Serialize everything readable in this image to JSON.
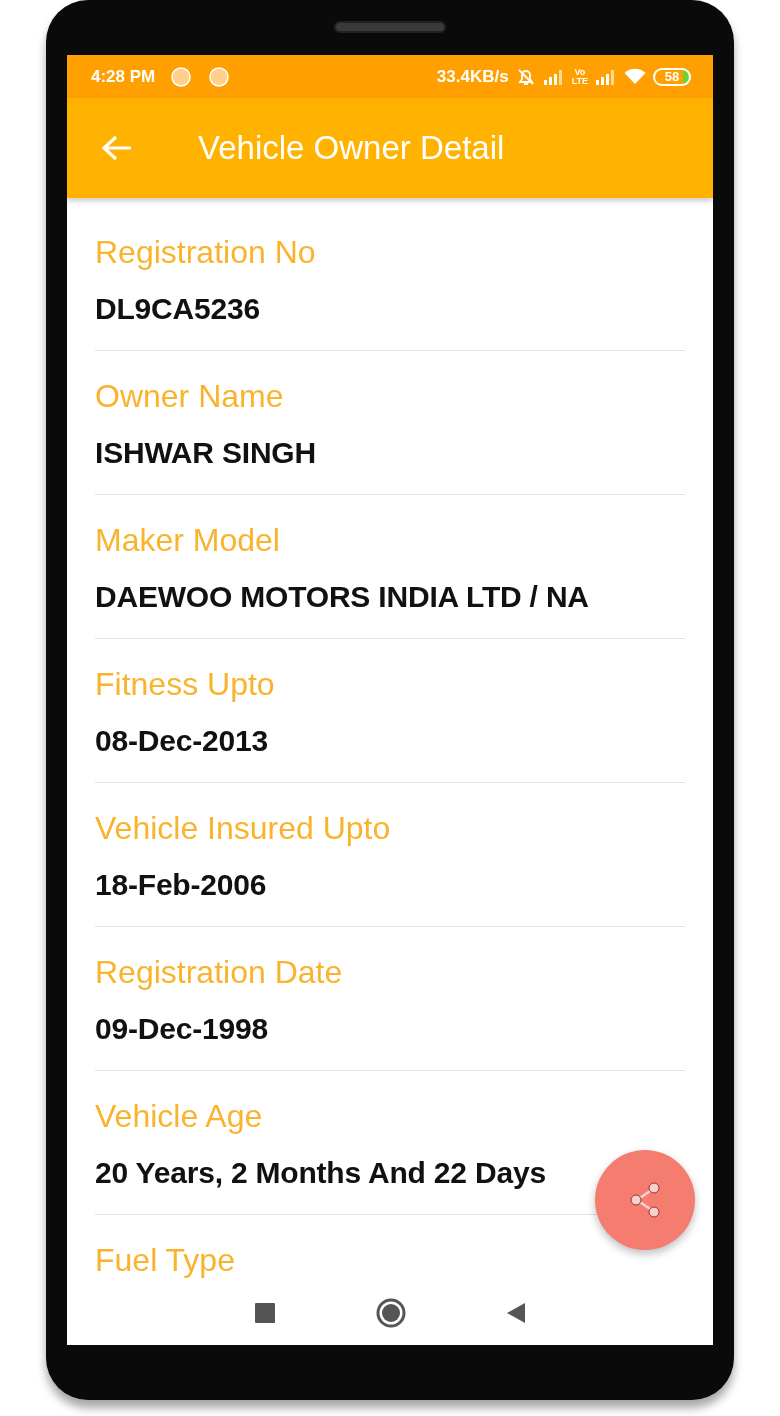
{
  "status_bar": {
    "time": "4:28 PM",
    "network_speed": "33.4KB/s",
    "volte_top": "Vo",
    "volte_bottom": "LTE",
    "battery": "58"
  },
  "app_bar": {
    "title": "Vehicle Owner Detail"
  },
  "fields": [
    {
      "label": "Registration No",
      "value": "DL9CA5236"
    },
    {
      "label": "Owner Name",
      "value": "ISHWAR SINGH"
    },
    {
      "label": "Maker Model",
      "value": "DAEWOO MOTORS INDIA LTD / NA"
    },
    {
      "label": "Fitness Upto",
      "value": "08-Dec-2013"
    },
    {
      "label": "Vehicle Insured Upto",
      "value": "18-Feb-2006"
    },
    {
      "label": "Registration Date",
      "value": "09-Dec-1998"
    },
    {
      "label": "Vehicle Age",
      "value": "20 Years, 2 Months And 22 Days"
    },
    {
      "label": "Fuel Type"
    }
  ]
}
